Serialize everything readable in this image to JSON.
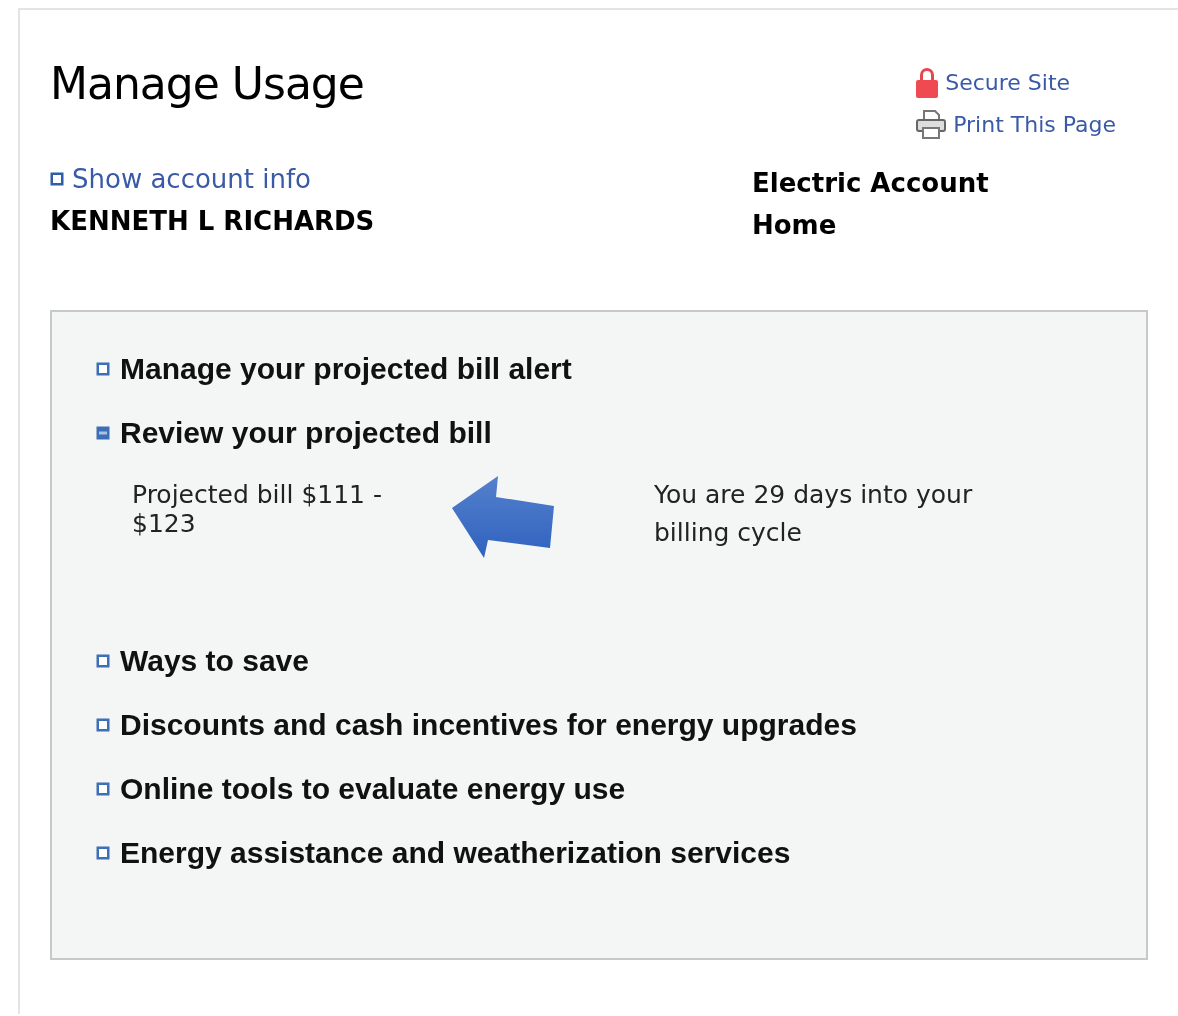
{
  "page": {
    "title": "Manage Usage"
  },
  "utility_links": [
    {
      "kind": "secure",
      "label": "Secure Site"
    },
    {
      "kind": "print",
      "label": "Print This Page"
    }
  ],
  "account": {
    "toggle_label": "Show account info",
    "expanded": false,
    "name": "KENNETH L RICHARDS",
    "type": "Electric Account",
    "premise": "Home"
  },
  "sections": [
    {
      "label": "Manage your projected bill alert",
      "expanded": false
    },
    {
      "label": "Review your projected bill",
      "expanded": true,
      "projected_bill": "Projected bill $111 - $123",
      "billing_cycle": "You are 29 days into your billing cycle"
    },
    {
      "label": "Ways to save",
      "expanded": false
    },
    {
      "label": "Discounts and cash incentives for energy upgrades",
      "expanded": false
    },
    {
      "label": "Online tools to evaluate energy use",
      "expanded": false
    },
    {
      "label": "Energy assistance and weatherization services",
      "expanded": false
    }
  ]
}
